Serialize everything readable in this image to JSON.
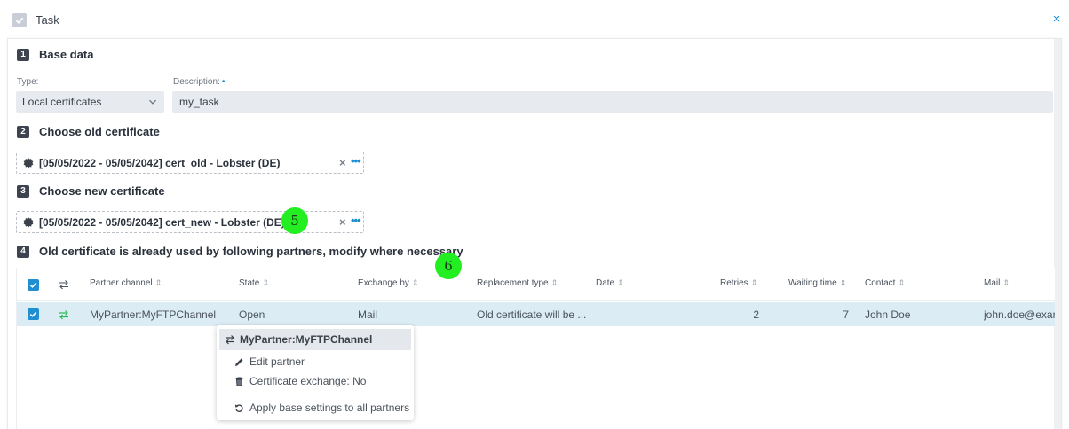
{
  "window": {
    "title": "Task",
    "close_glyph": "×"
  },
  "sections": {
    "base": {
      "num": "1",
      "title": "Base data"
    },
    "old": {
      "num": "2",
      "title": "Choose old certificate"
    },
    "new": {
      "num": "3",
      "title": "Choose new certificate"
    },
    "partners": {
      "num": "4",
      "title": "Old certificate is already used by following partners, modify where necessary"
    }
  },
  "fields": {
    "type_label": "Type:",
    "type_value": "Local certificates",
    "description_label": "Description:",
    "description_required_mark": "•",
    "description_value": "my_task"
  },
  "certs": {
    "old": "[05/05/2022 - 05/05/2042] cert_old - Lobster (DE)",
    "new": "[05/05/2022 - 05/05/2042] cert_new - Lobster (DE)",
    "clear_glyph": "×",
    "more_glyph": "•••"
  },
  "markers": {
    "m5": "5",
    "m6": "6"
  },
  "table": {
    "columns": [
      "Partner channel",
      "State",
      "Exchange by",
      "Replacement type",
      "Date",
      "Retries",
      "Waiting time",
      "Contact",
      "Mail"
    ],
    "sort_glyph": "⇕",
    "rows": [
      {
        "partner_channel": "MyPartner:MyFTPChannel",
        "state": "Open",
        "exchange_by": "Mail",
        "replacement_type": "Old certificate will be ...",
        "date": "",
        "retries": "2",
        "waiting_time": "7",
        "contact": "John Doe",
        "mail": "john.doe@exam"
      }
    ]
  },
  "context_menu": {
    "header": "MyPartner:MyFTPChannel",
    "items": [
      "Edit partner",
      "Certificate exchange: No",
      "Apply base settings to all partners"
    ]
  },
  "colors": {
    "accent": "#1f8fd1",
    "marker": "#22ee22",
    "row_selected": "#dcecf5"
  }
}
